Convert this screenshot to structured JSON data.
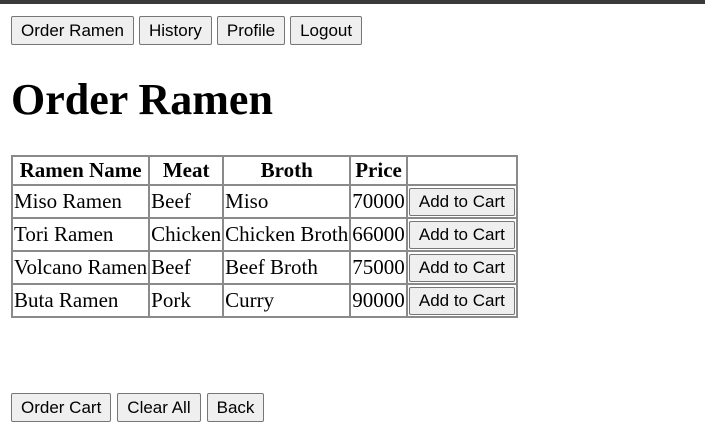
{
  "nav": {
    "order_ramen": "Order Ramen",
    "history": "History",
    "profile": "Profile",
    "logout": "Logout"
  },
  "page_title": "Order Ramen",
  "table": {
    "headers": [
      "Ramen Name",
      "Meat",
      "Broth",
      "Price",
      ""
    ],
    "rows": [
      {
        "name": "Miso Ramen",
        "meat": "Beef",
        "broth": "Miso",
        "price": "70000",
        "action": "Add to Cart"
      },
      {
        "name": "Tori Ramen",
        "meat": "Chicken",
        "broth": "Chicken Broth",
        "price": "66000",
        "action": "Add to Cart"
      },
      {
        "name": "Volcano Ramen",
        "meat": "Beef",
        "broth": "Beef Broth",
        "price": "75000",
        "action": "Add to Cart"
      },
      {
        "name": "Buta Ramen",
        "meat": "Pork",
        "broth": "Curry",
        "price": "90000",
        "action": "Add to Cart"
      }
    ]
  },
  "footer": {
    "order_cart": "Order Cart",
    "clear_all": "Clear All",
    "back": "Back"
  },
  "colors": {
    "top_bar": "#3a3a3a",
    "button_bg": "#efefef",
    "table_border": "#8a8a8a"
  }
}
